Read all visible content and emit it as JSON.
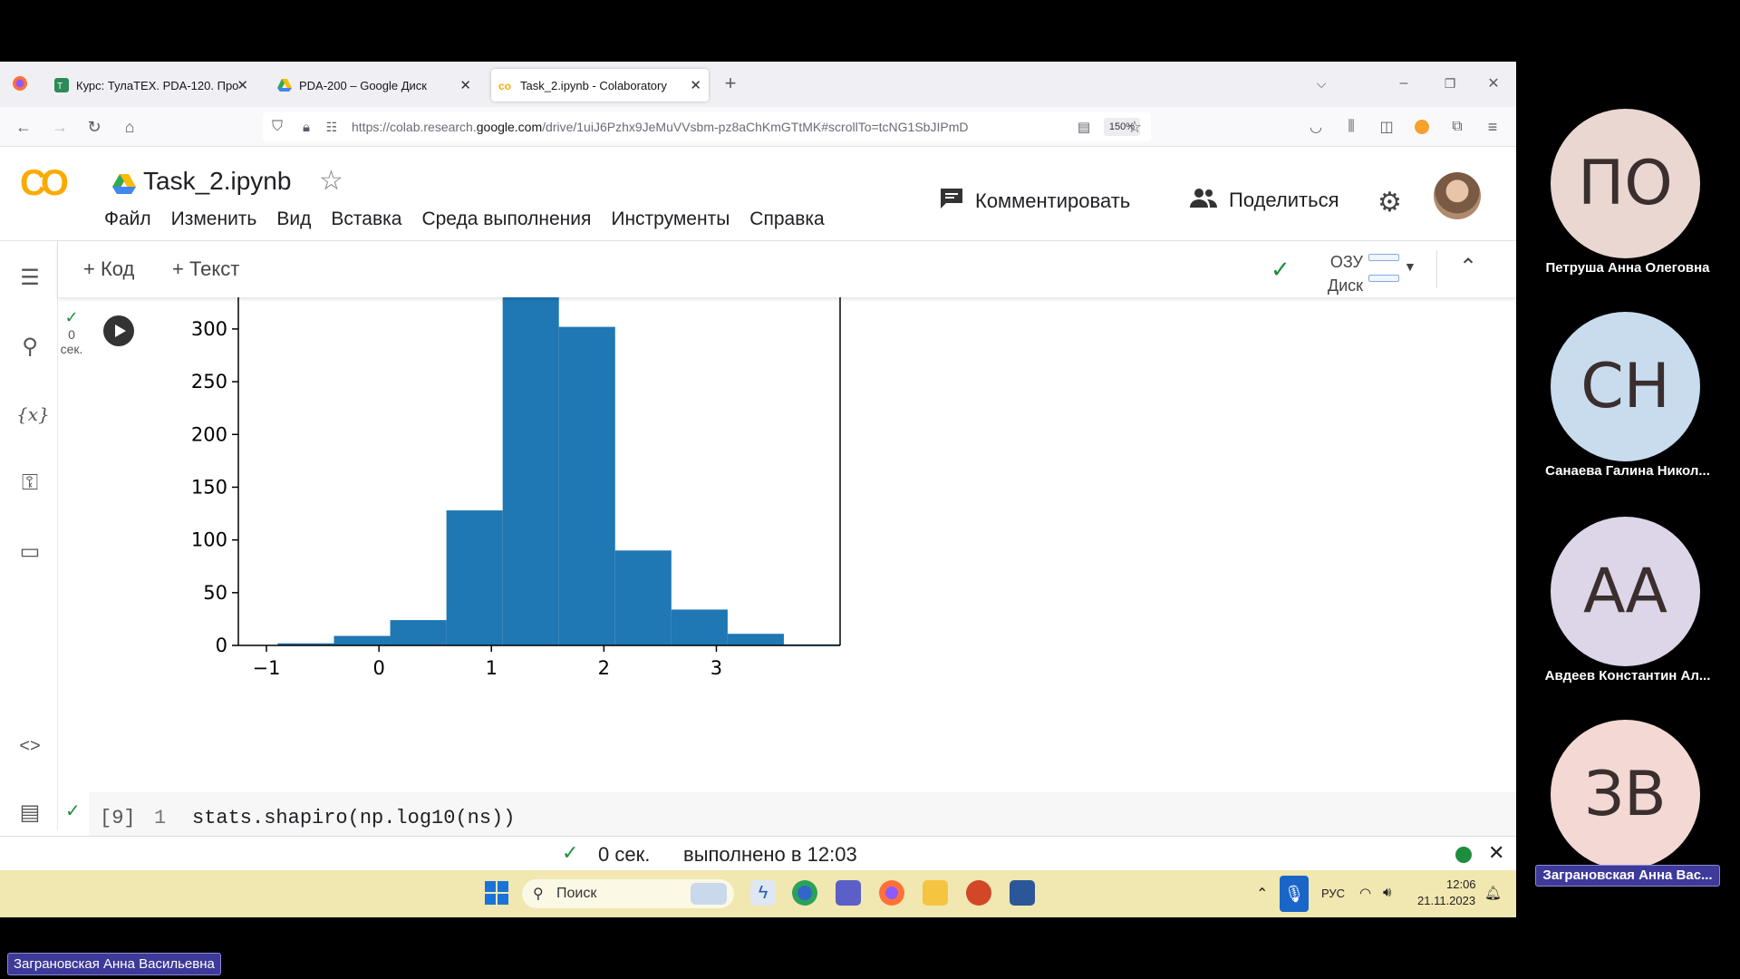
{
  "browser": {
    "tabs": [
      {
        "label": "Курс: ТулаТЕХ. PDA-120. Прог",
        "icon": "tulatex-icon"
      },
      {
        "label": "PDA-200 – Google Диск",
        "icon": "google-drive-icon"
      },
      {
        "label": "Task_2.ipynb - Colaboratory",
        "icon": "colab-icon",
        "active": true
      }
    ],
    "url_prefix": "https://colab.research.",
    "url_domain": "google.com",
    "url_rest": "/drive/1uiJ6Pzhx9JeMuVVsbm-pz8aChKmGTtMK#scrollTo=tcNG1SbJIPmD",
    "zoom": "150%"
  },
  "colab": {
    "logo": "CO",
    "notebook_title": "Task_2.ipynb",
    "menu": [
      "Файл",
      "Изменить",
      "Вид",
      "Вставка",
      "Среда выполнения",
      "Инструменты",
      "Справка"
    ],
    "comment_label": "Комментировать",
    "share_label": "Поделиться",
    "toolbar": {
      "add_code": "+ Код",
      "add_text": "+ Текст",
      "ram_label": "ОЗУ",
      "disk_label": "Диск"
    },
    "cell_status": {
      "time_value": "0",
      "time_unit": "сек."
    },
    "code_cell": {
      "exec_count": "[9]",
      "line_number": "1",
      "code": "stats.shapiro(np.log10(ns))"
    },
    "statusbar": {
      "time": "0 сек.",
      "done_text": "выполнено в 12:03"
    }
  },
  "chart_data": {
    "type": "bar",
    "bins": [
      {
        "x0": -0.9,
        "x1": -0.4,
        "value": 2
      },
      {
        "x0": -0.4,
        "x1": 0.1,
        "value": 9
      },
      {
        "x0": 0.1,
        "x1": 0.6,
        "value": 24
      },
      {
        "x0": 0.6,
        "x1": 1.1,
        "value": 128
      },
      {
        "x0": 1.1,
        "x1": 1.6,
        "value": 340
      },
      {
        "x0": 1.6,
        "x1": 2.1,
        "value": 302
      },
      {
        "x0": 2.1,
        "x1": 2.6,
        "value": 90
      },
      {
        "x0": 2.6,
        "x1": 3.1,
        "value": 34
      },
      {
        "x0": 3.1,
        "x1": 3.6,
        "value": 11
      },
      {
        "x0": 3.6,
        "x1": 4.1,
        "value": 1
      }
    ],
    "xticks": [
      -1,
      0,
      1,
      2,
      3
    ],
    "yticks": [
      0,
      50,
      100,
      150,
      200,
      250,
      300
    ],
    "xlim": [
      -1.25,
      4.1
    ],
    "ylim_visible": [
      0,
      330
    ],
    "bar_color": "#1f77b4"
  },
  "taskbar": {
    "search_placeholder": "Поиск",
    "lang": "РУС",
    "time": "12:06",
    "date": "21.11.2023"
  },
  "participants": [
    {
      "initials": "ПО",
      "name": "Петруша Анна Олеговна",
      "color": "#ead7d2"
    },
    {
      "initials": "СН",
      "name": "Санаева Галина Никол...",
      "color": "#c8dcee"
    },
    {
      "initials": "АА",
      "name": "Авдеев Константин Ал...",
      "color": "#ddd6e8"
    },
    {
      "initials": "ЗВ",
      "name": "Заграновская Анна Вас...",
      "color": "#f3d8d3",
      "speaking": true
    }
  ],
  "bottom_label": "Заграновская Анна Васильевна"
}
